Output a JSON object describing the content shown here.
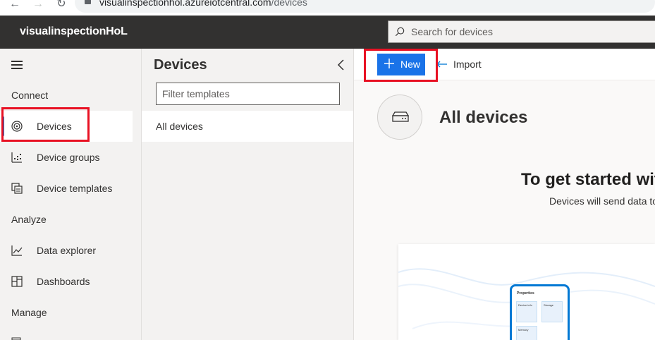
{
  "browser": {
    "back_icon": "arrow-left-icon",
    "forward_icon": "arrow-right-icon",
    "reload_icon": "reload-icon",
    "url_domain": "visualinspectionhol.azureiotcentral.com",
    "url_path": "/devices"
  },
  "header": {
    "app_name": "visualinspectionHoL",
    "search_placeholder": "Search for devices"
  },
  "sidebar": {
    "sections": [
      {
        "label": "Connect"
      },
      {
        "label": "Analyze"
      },
      {
        "label": "Manage"
      }
    ],
    "items": [
      {
        "label": "Devices",
        "icon": "devices-icon",
        "active": true
      },
      {
        "label": "Device groups",
        "icon": "device-groups-icon"
      },
      {
        "label": "Device templates",
        "icon": "device-templates-icon"
      },
      {
        "label": "Data explorer",
        "icon": "chart-icon"
      },
      {
        "label": "Dashboards",
        "icon": "dashboard-icon"
      }
    ]
  },
  "devices_panel": {
    "title": "Devices",
    "filter_placeholder": "Filter templates",
    "templates": [
      {
        "label": "All devices"
      }
    ]
  },
  "toolbar": {
    "new_label": "New",
    "import_label": "Import"
  },
  "main": {
    "title": "All devices",
    "empty_heading": "To get started wit",
    "empty_subtext": "Devices will send data to",
    "illustration": {
      "phone_title": "Properties",
      "cards": [
        "Device info",
        "Storage",
        "Memory"
      ]
    }
  },
  "colors": {
    "header_bg": "#323130",
    "nav_bg": "#f3f2f1",
    "primary": "#1a73e8",
    "active_bar": "#0078d4",
    "highlight_box": "#e81123"
  }
}
